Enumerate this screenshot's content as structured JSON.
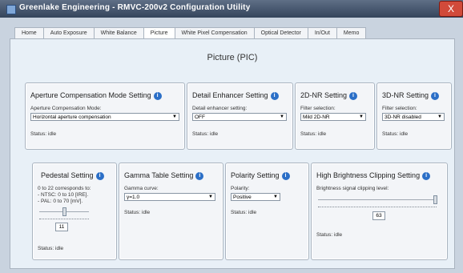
{
  "window": {
    "title": "Greenlake Engineering - RMVC-200v2 Configuration Utility",
    "close_label": "X"
  },
  "tabs": [
    {
      "label": "Home"
    },
    {
      "label": "Auto Exposure"
    },
    {
      "label": "White Balance"
    },
    {
      "label": "Picture"
    },
    {
      "label": "White Pixel Compensation"
    },
    {
      "label": "Optical Detector"
    },
    {
      "label": "In/Out"
    },
    {
      "label": "Memo"
    }
  ],
  "page": {
    "title": "Picture (PIC)"
  },
  "info_glyph": "i",
  "caret_glyph": "▼",
  "groups": {
    "aperture": {
      "title": "Aperture Compensation Mode Setting",
      "field_label": "Aperture Compensation Mode:",
      "value": "Horizontal aperture compensation",
      "status": "Status: idle"
    },
    "detail": {
      "title": "Detail Enhancer Setting",
      "field_label": "Detail enhancer setting:",
      "value": "OFF",
      "status": "Status: idle"
    },
    "nr2d": {
      "title": "2D-NR Setting",
      "field_label": "Filter selection:",
      "value": "Mild 2D-NR",
      "status": "Status: idle"
    },
    "nr3d": {
      "title": "3D-NR Setting",
      "field_label": "Filter selection:",
      "value": "3D-NR disabled",
      "status": "Status: idle"
    },
    "pedestal": {
      "title": "Pedestal Setting",
      "desc_line1": "0 to 22 corresponds to:",
      "desc_line2": "- NTSC: 0 to 10 [IRE].",
      "desc_line3": "- PAL: 0 to 70 [mV].",
      "value": "11",
      "level": 0.5,
      "status": "Status: idle"
    },
    "gamma": {
      "title": "Gamma Table Setting",
      "field_label": "Gamma curve:",
      "value": "γ=1.0",
      "status": "Status: idle"
    },
    "polarity": {
      "title": "Polarity Setting",
      "field_label": "Polarity:",
      "value": "Positive",
      "status": "Status: idle"
    },
    "clipping": {
      "title": "High Brightness Clipping Setting",
      "field_label": "Brightness signal clipping level:",
      "value": "63",
      "level": 1.0,
      "status": "Status: idle"
    }
  },
  "colors": {
    "accent": "#2b6fc7",
    "titlebar": "#34445b",
    "panel": "#e8f0f7"
  }
}
